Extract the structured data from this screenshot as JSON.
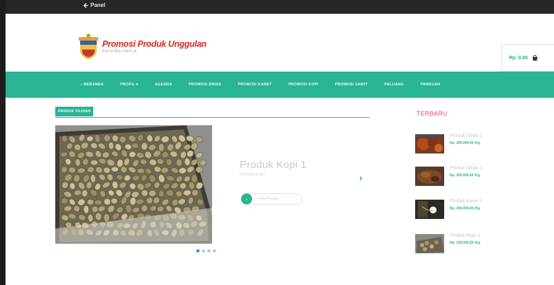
{
  "topbar": {
    "back_label": "Panel"
  },
  "brand": {
    "title": "Promosi Produk Unggulan",
    "subtitle": "PROVINSI PAPUA"
  },
  "cart": {
    "total": "Rp. 0.00",
    "count": "0"
  },
  "nav": {
    "items": [
      "⌂ BERANDA",
      "PROFIL ▾",
      "AGENDA",
      "PROMOSI DINAS",
      "PROMOSI KARET",
      "PROMOSI KOPI",
      "PROMOSI SAWIT",
      "PELUANG",
      "PANDUAN"
    ]
  },
  "featured": {
    "section_label": "PRODUK PILIHAN",
    "slide_title": "Produk Kopi 1",
    "slide_subtitle": "Promosi Kopi",
    "slide_button": "Detail Produk",
    "active_slide": 1,
    "slide_count": 4
  },
  "latest": {
    "title": "TERBARU",
    "products": [
      {
        "name": "Produk Sawit 1",
        "price": "Rp. 200.000,00 /Kg"
      },
      {
        "name": "Produk Dinas 1",
        "price": "Rp. 200.000,00 /Kg"
      },
      {
        "name": "Produk Karet 1",
        "price": "Rp. 200.000,00 /Kg"
      },
      {
        "name": "Produk Kopi 1",
        "price": "Rp. 200.000,00 /Kg"
      }
    ]
  }
}
